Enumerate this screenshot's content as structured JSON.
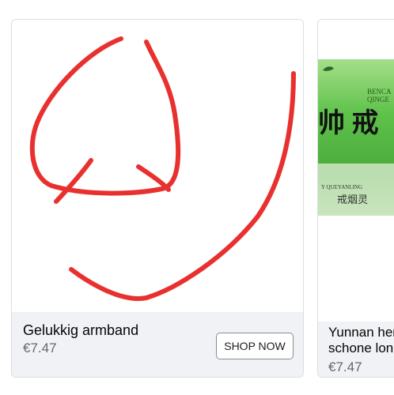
{
  "carousel": {
    "cards": [
      {
        "title": "Gelukkig armband",
        "price": "€7.47",
        "button_label": "SHOP NOW"
      },
      {
        "title": "Yunnan herbal schone long",
        "price": "€7.47",
        "package_text": {
          "brand_top": "BENCA",
          "brand_sub": "QINGE",
          "small_line": "Y QUEYANLING",
          "chinese_big": "帅 戒",
          "chinese_small": "戒烟灵"
        }
      }
    ]
  },
  "colors": {
    "drawing_stroke": "#e8312f",
    "footer_bg": "#f0f2f5",
    "package_green": "#5ec24a"
  },
  "icons": {
    "leaf": "leaf-icon"
  }
}
